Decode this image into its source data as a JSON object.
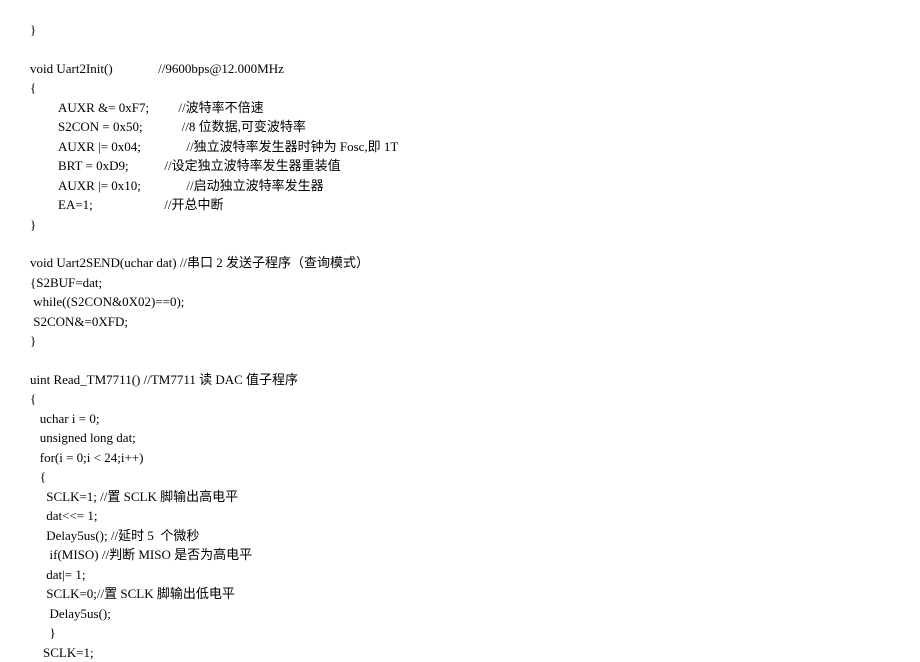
{
  "lines": [
    {
      "indent": 0,
      "text": "}"
    },
    {
      "indent": 0,
      "text": "",
      "blank": true
    },
    {
      "indent": 0,
      "text": "void Uart2Init()              //9600bps@12.000MHz"
    },
    {
      "indent": 0,
      "text": "{"
    },
    {
      "indent": 1,
      "text": "AUXR &= 0xF7;         //波特率不倍速"
    },
    {
      "indent": 1,
      "text": "S2CON = 0x50;            //8 位数据,可变波特率"
    },
    {
      "indent": 1,
      "text": "AUXR |= 0x04;              //独立波特率发生器时钟为 Fosc,即 1T"
    },
    {
      "indent": 1,
      "text": "BRT = 0xD9;           //设定独立波特率发生器重装值"
    },
    {
      "indent": 1,
      "text": "AUXR |= 0x10;              //启动独立波特率发生器"
    },
    {
      "indent": 1,
      "text": "EA=1;                      //开总中断"
    },
    {
      "indent": 0,
      "text": "}"
    },
    {
      "indent": 0,
      "text": "",
      "blank": true
    },
    {
      "indent": 0,
      "text": "void Uart2SEND(uchar dat) //串口 2 发送子程序（查询模式）"
    },
    {
      "indent": 0,
      "text": "{S2BUF=dat;"
    },
    {
      "indent": 0,
      "text": " while((S2CON&0X02)==0);"
    },
    {
      "indent": 0,
      "text": " S2CON&=0XFD;"
    },
    {
      "indent": 0,
      "text": "}"
    },
    {
      "indent": 0,
      "text": "",
      "blank": true
    },
    {
      "indent": 0,
      "text": "uint Read_TM7711() //TM7711 读 DAC 值子程序"
    },
    {
      "indent": 0,
      "text": "{"
    },
    {
      "indent": 0,
      "text": "   uchar i = 0;"
    },
    {
      "indent": 0,
      "text": "   unsigned long dat;"
    },
    {
      "indent": 0,
      "text": "   for(i = 0;i < 24;i++)"
    },
    {
      "indent": 0,
      "text": "   {"
    },
    {
      "indent": 0,
      "text": "     SCLK=1; //置 SCLK 脚输出高电平"
    },
    {
      "indent": 0,
      "text": "     dat<<= 1;"
    },
    {
      "indent": 0,
      "text": "     Delay5us(); //延时 5  个微秒"
    },
    {
      "indent": 0,
      "text": "      if(MISO) //判断 MISO 是否为高电平"
    },
    {
      "indent": 0,
      "text": "     dat|= 1;"
    },
    {
      "indent": 0,
      "text": "     SCLK=0;//置 SCLK 脚输出低电平"
    },
    {
      "indent": 0,
      "text": "      Delay5us();"
    },
    {
      "indent": 0,
      "text": "      }"
    },
    {
      "indent": 0,
      "text": "    SCLK=1;"
    }
  ]
}
